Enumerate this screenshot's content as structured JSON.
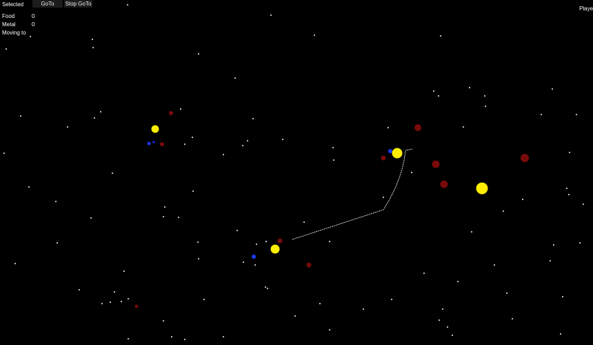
{
  "hud": {
    "selected_label": "Selected",
    "goto_label": "GoTo",
    "stop_goto_label": "Stop GoTo",
    "food_label": "Food",
    "food_value": "0",
    "metal_label": "Metal",
    "metal_value": "0",
    "moving_to_label": "Moving to",
    "player_label": "Playe"
  },
  "colors": {
    "background": "#000000",
    "star": "#cfcfcf",
    "sun": "#ffee00",
    "enemy_planet": "#7a0a0a",
    "player_planet": "#1a3aff",
    "path": "#dddddd"
  }
}
